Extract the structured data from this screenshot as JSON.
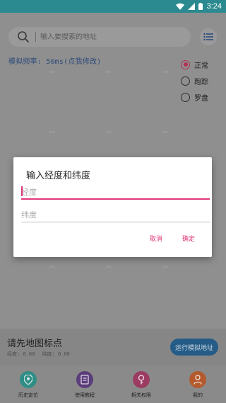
{
  "status_bar": {
    "time": "3:24"
  },
  "search": {
    "placeholder": "输入要搜索的地址"
  },
  "frequency_label": "模拟频率: 50ms(点我修改)",
  "modes": [
    {
      "label": "正常",
      "selected": true
    },
    {
      "label": "跑踪",
      "selected": false
    },
    {
      "label": "罗盘",
      "selected": false
    }
  ],
  "bottom_panel": {
    "title": "请先地图标点",
    "longitude": "经度: 0.00",
    "latitude": "纬度: 0.00",
    "run_label": "运行模拟地址"
  },
  "tabs": [
    {
      "label": "历史定位",
      "icon": "location-pin-icon",
      "color": "#2f8e86"
    },
    {
      "label": "使用教程",
      "icon": "document-icon",
      "color": "#5b3d7a"
    },
    {
      "label": "相关权限",
      "icon": "key-icon",
      "color": "#9c3b62"
    },
    {
      "label": "我的",
      "icon": "person-icon",
      "color": "#b35a2f"
    }
  ],
  "dialog": {
    "title": "输入经度和纬度",
    "longitude_placeholder": "经度",
    "latitude_placeholder": "纬度",
    "cancel_label": "取消",
    "confirm_label": "确定"
  },
  "colors": {
    "accent": "#e0387a",
    "status_bar": "#2b8a8f",
    "primary_button": "#245c87"
  }
}
